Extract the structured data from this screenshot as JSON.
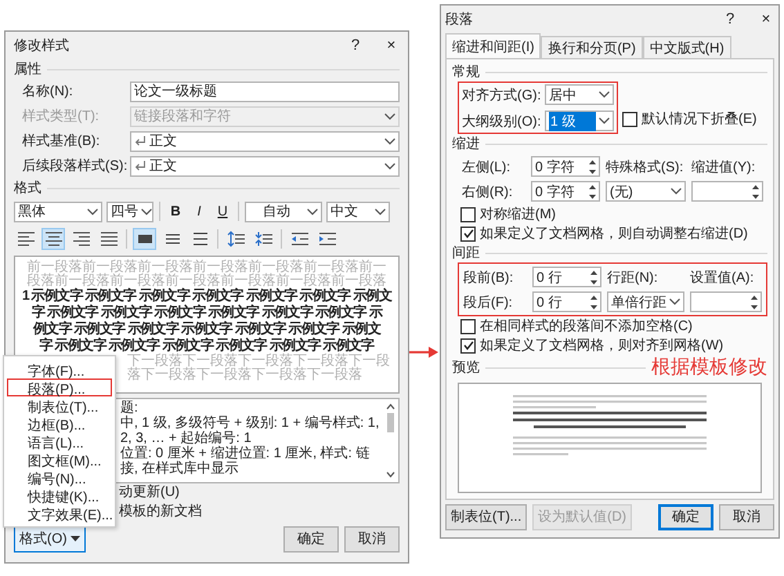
{
  "modify_style_dialog": {
    "title": "修改样式",
    "help": "?",
    "close": "×",
    "properties": {
      "heading": "属性",
      "fields": [
        {
          "label": "名称(N):",
          "value": "论文一级标题",
          "kind": "text",
          "disabled": false
        },
        {
          "label": "样式类型(T):",
          "value": "链接段落和字符",
          "kind": "select",
          "disabled": true
        },
        {
          "label": "样式基准(B):",
          "value": "正文",
          "kind": "style-select",
          "disabled": false
        },
        {
          "label": "后续段落样式(S):",
          "value": "正文",
          "kind": "style-select",
          "disabled": false
        }
      ]
    },
    "format": {
      "heading": "格式",
      "font": "黑体",
      "size": "四号",
      "bold": "B",
      "italic": "I",
      "underline": "U",
      "font_color": "自动",
      "script": "中文",
      "alignment": [
        {
          "kind": "align-left",
          "selected": false
        },
        {
          "kind": "align-center",
          "selected": true
        },
        {
          "kind": "align-right",
          "selected": false
        },
        {
          "kind": "justify",
          "selected": false
        }
      ],
      "line_spacing": [
        {
          "kind": "single-spacing",
          "selected": true
        },
        {
          "kind": "one-half-spacing",
          "selected": false
        },
        {
          "kind": "double-spacing",
          "selected": false
        }
      ],
      "paragraph_spacing": [
        {
          "kind": "space-before"
        },
        {
          "kind": "space-after"
        }
      ],
      "indent": [
        {
          "kind": "indent-decrease"
        },
        {
          "kind": "indent-increase"
        }
      ]
    },
    "preview": {
      "previous": "前一段落前一段落前一段落前一段落前一段落前一段落前一段落前一段落前一段落前一段落前一段落前一段落前一段落",
      "sample": [
        "1 示例文字 示例文字 示例文字 示例文字 示例文字 示例文字 示例文",
        "字 示例文字 示例文字 示例文字 示例文字 示例文字 示例文字 示",
        "例文字 示例文字 示例文字 示例文字 示例文字 示例文字 示例文",
        "字 示例文字 示例文字 示例文字 示例文字 示例文字 示例文字"
      ],
      "next": "下一段落下一段落下一段落下一段落下一段落下一段落下一段落下一段落下一段落"
    },
    "description": [
      "题:",
      "中, 1 级, 多级符号 + 级别: 1 + 编号样式: 1, 2, 3, … + 起始编号: 1",
      "位置: 0 厘米 + 缩进位置: 1 厘米, 样式: 链接, 在样式库中显示"
    ],
    "options": [
      "动更新(U)",
      "模板的新文档"
    ],
    "format_button": "格式(O)",
    "ok": "确定",
    "cancel": "取消",
    "menu": [
      {
        "label": "字体(F)...",
        "highlighted": false
      },
      {
        "label": "段落(P)...",
        "highlighted": true
      },
      {
        "label": "制表位(T)...",
        "highlighted": false
      },
      {
        "label": "边框(B)...",
        "highlighted": false
      },
      {
        "label": "语言(L)...",
        "highlighted": false
      },
      {
        "label": "图文框(M)...",
        "highlighted": false
      },
      {
        "label": "编号(N)...",
        "highlighted": false
      },
      {
        "label": "快捷键(K)...",
        "highlighted": false
      },
      {
        "label": "文字效果(E)...",
        "highlighted": false
      }
    ]
  },
  "paragraph_dialog": {
    "title": "段落",
    "help": "?",
    "close": "×",
    "tabs": [
      {
        "label": "缩进和间距(I)",
        "selected": true
      },
      {
        "label": "换行和分页(P)",
        "selected": false
      },
      {
        "label": "中文版式(H)",
        "selected": false
      }
    ],
    "general": {
      "heading": "常规",
      "highlighted": true,
      "alignment_label": "对齐方式(G):",
      "alignment": "居中",
      "outline_label": "大纲级别(O):",
      "outline": "1 级",
      "outline_selected": true,
      "collapse": {
        "label": "默认情况下折叠(E)",
        "checked": false
      }
    },
    "indent": {
      "heading": "缩进",
      "left_label": "左侧(L):",
      "left": "0 字符",
      "right_label": "右侧(R):",
      "right": "0 字符",
      "special_label": "特殊格式(S):",
      "special": "(无)",
      "by_label": "缩进值(Y):",
      "checkboxes": [
        {
          "label": "对称缩进(M)",
          "checked": false
        },
        {
          "label": "如果定义了文档网格，则自动调整右缩进(D)",
          "checked": true
        }
      ]
    },
    "spacing": {
      "heading": "间距",
      "highlighted": true,
      "before_label": "段前(B):",
      "before": "0 行",
      "after_label": "段后(F):",
      "after": "0 行",
      "line_label": "行距(N):",
      "line": "单倍行距",
      "at_label": "设置值(A):",
      "checkboxes": [
        {
          "label": "在相同样式的段落间不添加空格(C)",
          "checked": false
        },
        {
          "label": "如果定义了文档网格，则对齐到网格(W)",
          "checked": true
        }
      ]
    },
    "preview_heading": "预览",
    "tabs_button": "制表位(T)...",
    "default_button": {
      "label": "设为默认值(D)",
      "disabled": true
    },
    "ok": "确定",
    "cancel": "取消"
  },
  "annotation": "根据模板修改"
}
